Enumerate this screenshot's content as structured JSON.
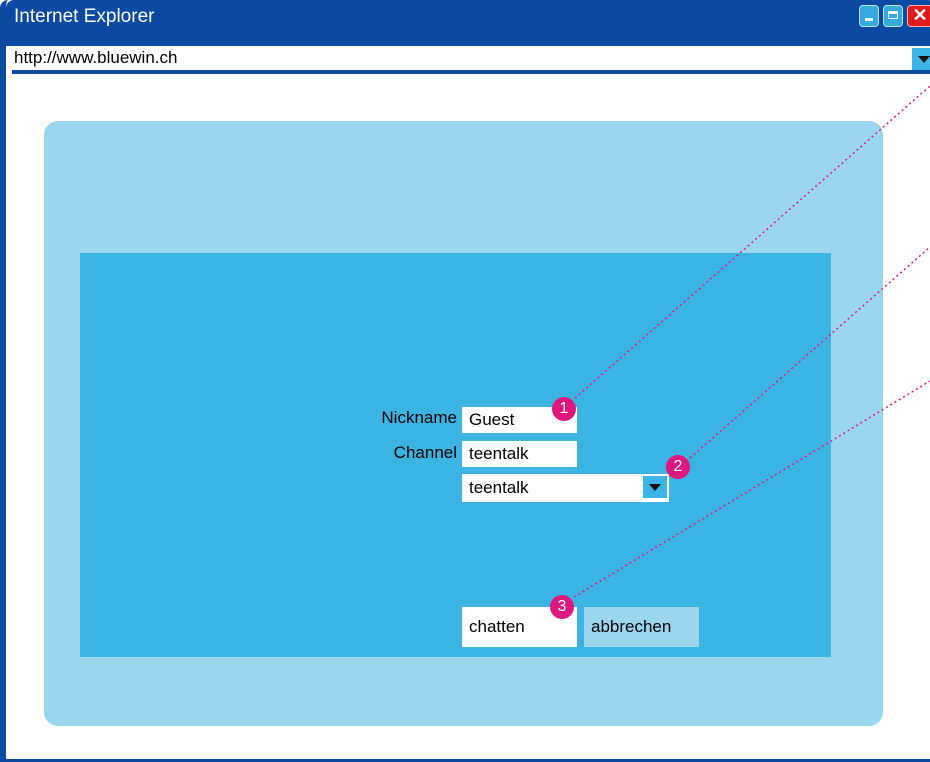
{
  "window": {
    "title": "Internet Explorer",
    "close_glyph": "✕"
  },
  "address_bar": {
    "url": "http://www.bluewin.ch"
  },
  "form": {
    "nickname_label": "Nickname",
    "nickname_value": "Guest",
    "channel_label": "Channel",
    "channel_value": "teentalk",
    "channel_select_value": "teentalk",
    "chat_button": "chatten",
    "cancel_button": "abbrechen"
  },
  "callouts": [
    "1",
    "2",
    "3"
  ],
  "colors": {
    "chrome_blue": "#0b4aa2",
    "outer_panel": "#9ad7ef",
    "inner_panel": "#3cb4e3",
    "callout_magenta": "#e0167f"
  }
}
